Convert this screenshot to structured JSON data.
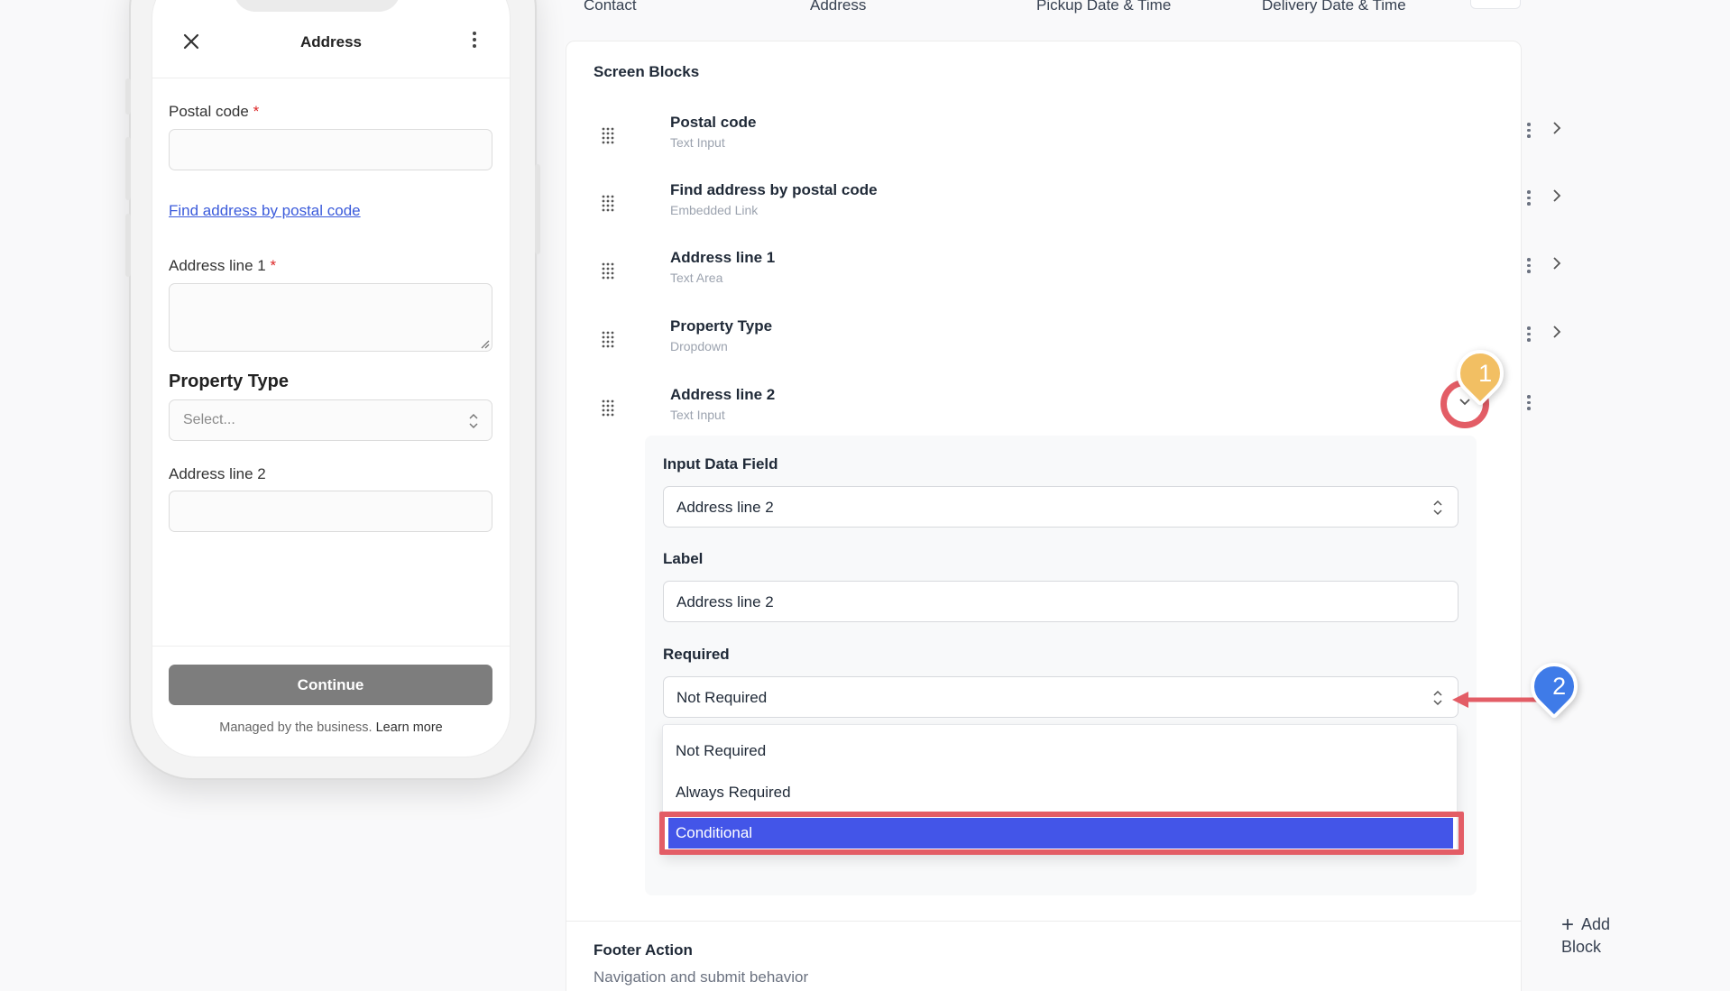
{
  "top_nav": {
    "tabs": [
      "Contact",
      "Address",
      "Pickup Date & Time",
      "Delivery Date & Time"
    ]
  },
  "phone": {
    "header_title": "Address",
    "postal_code_label": "Postal code",
    "required_mark": "*",
    "find_address_link": "Find address by postal code",
    "address_line1_label": "Address line 1",
    "property_type_heading": "Property Type",
    "property_type_placeholder": "Select...",
    "address_line2_label": "Address line 2",
    "continue_label": "Continue",
    "managed_text": "Managed by the business.",
    "learn_more": "Learn more"
  },
  "editor": {
    "section_title": "Screen Blocks",
    "blocks": [
      {
        "name": "Postal code",
        "type": "Text Input"
      },
      {
        "name": "Find address by postal code",
        "type": "Embedded Link"
      },
      {
        "name": "Address line 1",
        "type": "Text Area"
      },
      {
        "name": "Property Type",
        "type": "Dropdown"
      },
      {
        "name": "Address line 2",
        "type": "Text Input"
      }
    ],
    "expanded": {
      "input_data_field_label": "Input Data Field",
      "input_data_field_value": "Address line 2",
      "label_label": "Label",
      "label_value": "Address line 2",
      "required_label": "Required",
      "required_value": "Not Required",
      "required_options": [
        "Not Required",
        "Always Required",
        "Conditional"
      ],
      "selected_option": "Conditional"
    },
    "add_block_label": "Add Block",
    "footer_title": "Footer Action",
    "footer_subtitle": "Navigation and submit behavior"
  },
  "annotations": {
    "step1": "1",
    "step2": "2",
    "colors": {
      "step1": "#f2bf63",
      "step2": "#3f7be8",
      "highlight": "#e35d66",
      "selected": "#4355e8"
    }
  }
}
